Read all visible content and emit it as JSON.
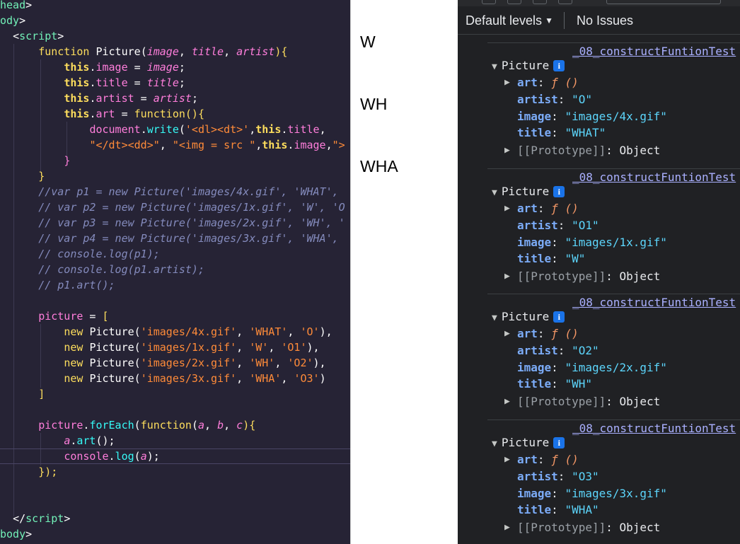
{
  "editor": {
    "lines": [
      [
        {
          "t": "head",
          "c": "tag"
        },
        {
          "t": ">",
          "c": "w"
        }
      ],
      [
        {
          "t": "ody",
          "c": "tag"
        },
        {
          "t": ">",
          "c": "w"
        }
      ],
      [
        {
          "t": "  ",
          "c": "w"
        },
        {
          "t": "<",
          "c": "w"
        },
        {
          "t": "script",
          "c": "tag"
        },
        {
          "t": ">",
          "c": "w"
        }
      ],
      [
        {
          "t": "      ",
          "c": "w"
        },
        {
          "t": "function ",
          "c": "k"
        },
        {
          "t": "Picture",
          "c": "w"
        },
        {
          "t": "(",
          "c": "w"
        },
        {
          "t": "image",
          "c": "p"
        },
        {
          "t": ", ",
          "c": "w"
        },
        {
          "t": "title",
          "c": "p"
        },
        {
          "t": ", ",
          "c": "w"
        },
        {
          "t": "artist",
          "c": "p"
        },
        {
          "t": "){",
          "c": "y"
        }
      ],
      [
        {
          "t": "          ",
          "c": "w"
        },
        {
          "t": "this",
          "c": "th"
        },
        {
          "t": ".",
          "c": "w"
        },
        {
          "t": "image",
          "c": "pp"
        },
        {
          "t": " = ",
          "c": "w"
        },
        {
          "t": "image",
          "c": "p"
        },
        {
          "t": ";",
          "c": "w"
        }
      ],
      [
        {
          "t": "          ",
          "c": "w"
        },
        {
          "t": "this",
          "c": "th"
        },
        {
          "t": ".",
          "c": "w"
        },
        {
          "t": "title",
          "c": "pp"
        },
        {
          "t": " = ",
          "c": "w"
        },
        {
          "t": "title",
          "c": "p"
        },
        {
          "t": ";",
          "c": "w"
        }
      ],
      [
        {
          "t": "          ",
          "c": "w"
        },
        {
          "t": "this",
          "c": "th"
        },
        {
          "t": ".",
          "c": "w"
        },
        {
          "t": "artist",
          "c": "pp"
        },
        {
          "t": " = ",
          "c": "w"
        },
        {
          "t": "artist",
          "c": "p"
        },
        {
          "t": ";",
          "c": "w"
        }
      ],
      [
        {
          "t": "          ",
          "c": "w"
        },
        {
          "t": "this",
          "c": "th"
        },
        {
          "t": ".",
          "c": "w"
        },
        {
          "t": "art",
          "c": "pp"
        },
        {
          "t": " = ",
          "c": "w"
        },
        {
          "t": "function",
          "c": "k"
        },
        {
          "t": "(){",
          "c": "y"
        }
      ],
      [
        {
          "t": "              ",
          "c": "w"
        },
        {
          "t": "document",
          "c": "m"
        },
        {
          "t": ".",
          "c": "w"
        },
        {
          "t": "write",
          "c": "fn"
        },
        {
          "t": "(",
          "c": "w"
        },
        {
          "t": "'<dl><dt>'",
          "c": "s"
        },
        {
          "t": ",",
          "c": "w"
        },
        {
          "t": "this",
          "c": "th"
        },
        {
          "t": ".",
          "c": "w"
        },
        {
          "t": "title",
          "c": "pp"
        },
        {
          "t": ",",
          "c": "w"
        }
      ],
      [
        {
          "t": "              ",
          "c": "w"
        },
        {
          "t": "\"</dt><dd>\"",
          "c": "s"
        },
        {
          "t": ", ",
          "c": "w"
        },
        {
          "t": "\"<img = src \"",
          "c": "s"
        },
        {
          "t": ",",
          "c": "w"
        },
        {
          "t": "this",
          "c": "th"
        },
        {
          "t": ".",
          "c": "w"
        },
        {
          "t": "image",
          "c": "pp"
        },
        {
          "t": ",",
          "c": "w"
        },
        {
          "t": "\">",
          "c": "s"
        }
      ],
      [
        {
          "t": "          ",
          "c": "w"
        },
        {
          "t": "}",
          "c": "pp"
        }
      ],
      [
        {
          "t": "      ",
          "c": "w"
        },
        {
          "t": "}",
          "c": "y"
        }
      ],
      [
        {
          "t": "      ",
          "c": "w"
        },
        {
          "t": "//var p1 = new Picture('images/4x.gif', 'WHAT',",
          "c": "c"
        }
      ],
      [
        {
          "t": "      ",
          "c": "w"
        },
        {
          "t": "// var p2 = new Picture('images/1x.gif', 'W', 'O",
          "c": "c"
        }
      ],
      [
        {
          "t": "      ",
          "c": "w"
        },
        {
          "t": "// var p3 = new Picture('images/2x.gif', 'WH', '",
          "c": "c"
        }
      ],
      [
        {
          "t": "      ",
          "c": "w"
        },
        {
          "t": "// var p4 = new Picture('images/3x.gif', 'WHA',",
          "c": "c"
        }
      ],
      [
        {
          "t": "      ",
          "c": "w"
        },
        {
          "t": "// console.log(p1);",
          "c": "c"
        }
      ],
      [
        {
          "t": "      ",
          "c": "w"
        },
        {
          "t": "// console.log(p1.artist);",
          "c": "c"
        }
      ],
      [
        {
          "t": "      ",
          "c": "w"
        },
        {
          "t": "// p1.art();",
          "c": "c"
        }
      ],
      [
        {
          "t": "",
          "c": "w"
        }
      ],
      [
        {
          "t": "      ",
          "c": "w"
        },
        {
          "t": "picture",
          "c": "pp"
        },
        {
          "t": " = ",
          "c": "w"
        },
        {
          "t": "[",
          "c": "y"
        }
      ],
      [
        {
          "t": "          ",
          "c": "w"
        },
        {
          "t": "new ",
          "c": "k"
        },
        {
          "t": "Picture",
          "c": "w"
        },
        {
          "t": "(",
          "c": "w"
        },
        {
          "t": "'images/4x.gif'",
          "c": "s"
        },
        {
          "t": ", ",
          "c": "w"
        },
        {
          "t": "'WHAT'",
          "c": "s"
        },
        {
          "t": ", ",
          "c": "w"
        },
        {
          "t": "'O'",
          "c": "s"
        },
        {
          "t": "),",
          "c": "w"
        }
      ],
      [
        {
          "t": "          ",
          "c": "w"
        },
        {
          "t": "new ",
          "c": "k"
        },
        {
          "t": "Picture",
          "c": "w"
        },
        {
          "t": "(",
          "c": "w"
        },
        {
          "t": "'images/1x.gif'",
          "c": "s"
        },
        {
          "t": ", ",
          "c": "w"
        },
        {
          "t": "'W'",
          "c": "s"
        },
        {
          "t": ", ",
          "c": "w"
        },
        {
          "t": "'O1'",
          "c": "s"
        },
        {
          "t": "),",
          "c": "w"
        }
      ],
      [
        {
          "t": "          ",
          "c": "w"
        },
        {
          "t": "new ",
          "c": "k"
        },
        {
          "t": "Picture",
          "c": "w"
        },
        {
          "t": "(",
          "c": "w"
        },
        {
          "t": "'images/2x.gif'",
          "c": "s"
        },
        {
          "t": ", ",
          "c": "w"
        },
        {
          "t": "'WH'",
          "c": "s"
        },
        {
          "t": ", ",
          "c": "w"
        },
        {
          "t": "'O2'",
          "c": "s"
        },
        {
          "t": "),",
          "c": "w"
        }
      ],
      [
        {
          "t": "          ",
          "c": "w"
        },
        {
          "t": "new ",
          "c": "k"
        },
        {
          "t": "Picture",
          "c": "w"
        },
        {
          "t": "(",
          "c": "w"
        },
        {
          "t": "'images/3x.gif'",
          "c": "s"
        },
        {
          "t": ", ",
          "c": "w"
        },
        {
          "t": "'WHA'",
          "c": "s"
        },
        {
          "t": ", ",
          "c": "w"
        },
        {
          "t": "'O3'",
          "c": "s"
        },
        {
          "t": ")",
          "c": "w"
        }
      ],
      [
        {
          "t": "      ",
          "c": "w"
        },
        {
          "t": "]",
          "c": "y"
        }
      ],
      [
        {
          "t": "",
          "c": "w"
        }
      ],
      [
        {
          "t": "      ",
          "c": "w"
        },
        {
          "t": "picture",
          "c": "pp"
        },
        {
          "t": ".",
          "c": "w"
        },
        {
          "t": "forEach",
          "c": "fn"
        },
        {
          "t": "(",
          "c": "w"
        },
        {
          "t": "function",
          "c": "k"
        },
        {
          "t": "(",
          "c": "w"
        },
        {
          "t": "a",
          "c": "p"
        },
        {
          "t": ", ",
          "c": "w"
        },
        {
          "t": "b",
          "c": "p"
        },
        {
          "t": ", ",
          "c": "w"
        },
        {
          "t": "c",
          "c": "p"
        },
        {
          "t": "){",
          "c": "y"
        }
      ],
      [
        {
          "t": "          ",
          "c": "w"
        },
        {
          "t": "a",
          "c": "p"
        },
        {
          "t": ".",
          "c": "w"
        },
        {
          "t": "art",
          "c": "fn"
        },
        {
          "t": "();",
          "c": "w"
        }
      ],
      [
        {
          "t": "          ",
          "c": "w"
        },
        {
          "t": "console",
          "c": "m"
        },
        {
          "t": ".",
          "c": "w"
        },
        {
          "t": "log",
          "c": "fn"
        },
        {
          "t": "(",
          "c": "w"
        },
        {
          "t": "a",
          "c": "p"
        },
        {
          "t": ");",
          "c": "w"
        }
      ],
      [
        {
          "t": "      ",
          "c": "w"
        },
        {
          "t": "});",
          "c": "y"
        }
      ],
      [
        {
          "t": "",
          "c": "w"
        }
      ],
      [
        {
          "t": "",
          "c": "w"
        }
      ],
      [
        {
          "t": "  ",
          "c": "w"
        },
        {
          "t": "</",
          "c": "w"
        },
        {
          "t": "script",
          "c": "tag"
        },
        {
          "t": ">",
          "c": "w"
        }
      ],
      [
        {
          "t": "body",
          "c": "tag"
        },
        {
          "t": ">",
          "c": "w"
        }
      ]
    ]
  },
  "document_output": {
    "lines": [
      "W",
      "WH",
      "WHA"
    ]
  },
  "console": {
    "levels_label": "Default levels",
    "issues_label": "No Issues",
    "entries": [
      {
        "source": "_08_constructFuntionTest",
        "name": "Picture",
        "info": "i",
        "art_label": "art",
        "art_value": "ƒ ()",
        "artist": "\"O\"",
        "image": "\"images/4x.gif\"",
        "title": "\"WHAT\"",
        "proto_label": "[[Prototype]]",
        "proto_value": "Object"
      },
      {
        "source": "_08_constructFuntionTest",
        "name": "Picture",
        "info": "i",
        "art_label": "art",
        "art_value": "ƒ ()",
        "artist": "\"O1\"",
        "image": "\"images/1x.gif\"",
        "title": "\"W\"",
        "proto_label": "[[Prototype]]",
        "proto_value": "Object"
      },
      {
        "source": "_08_constructFuntionTest",
        "name": "Picture",
        "info": "i",
        "art_label": "art",
        "art_value": "ƒ ()",
        "artist": "\"O2\"",
        "image": "\"images/2x.gif\"",
        "title": "\"WH\"",
        "proto_label": "[[Prototype]]",
        "proto_value": "Object"
      },
      {
        "source": "_08_constructFuntionTest",
        "name": "Picture",
        "info": "i",
        "art_label": "art",
        "art_value": "ƒ ()",
        "artist": "\"O3\"",
        "image": "\"images/3x.gif\"",
        "title": "\"WHA\"",
        "proto_label": "[[Prototype]]",
        "proto_value": "Object"
      }
    ],
    "field_keys": {
      "artist": "artist",
      "image": "image",
      "title": "title"
    }
  }
}
